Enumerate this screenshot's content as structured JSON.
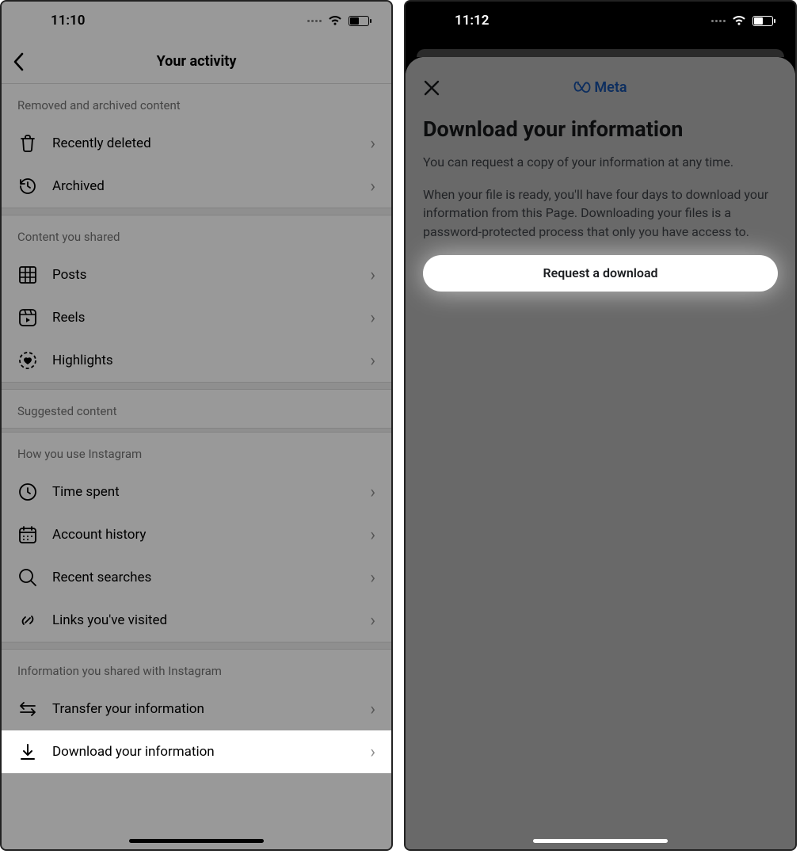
{
  "left": {
    "time": "11:10",
    "header_title": "Your activity",
    "sections": {
      "removed": {
        "title": "Removed and archived content",
        "items": [
          {
            "label": "Recently deleted",
            "icon": "trash-icon"
          },
          {
            "label": "Archived",
            "icon": "history-icon"
          }
        ]
      },
      "content_shared": {
        "title": "Content you shared",
        "items": [
          {
            "label": "Posts",
            "icon": "grid-icon"
          },
          {
            "label": "Reels",
            "icon": "reels-icon"
          },
          {
            "label": "Highlights",
            "icon": "highlights-icon"
          }
        ]
      },
      "suggested": {
        "title": "Suggested content"
      },
      "how_use": {
        "title": "How you use Instagram",
        "items": [
          {
            "label": "Time spent",
            "icon": "clock-icon"
          },
          {
            "label": "Account history",
            "icon": "calendar-icon"
          },
          {
            "label": "Recent searches",
            "icon": "search-icon"
          },
          {
            "label": "Links you've visited",
            "icon": "link-icon"
          }
        ]
      },
      "info_shared": {
        "title": "Information you shared with Instagram",
        "items": [
          {
            "label": "Transfer your information",
            "icon": "transfer-icon"
          },
          {
            "label": "Download your information",
            "icon": "download-icon"
          }
        ]
      }
    }
  },
  "right": {
    "time": "11:12",
    "logo_text": "Meta",
    "title": "Download your information",
    "para1": "You can request a copy of your information at any time.",
    "para2": "When your file is ready, you'll have four days to download your information from this Page. Downloading your files is a password-protected process that only you have access to.",
    "button": "Request a download"
  }
}
